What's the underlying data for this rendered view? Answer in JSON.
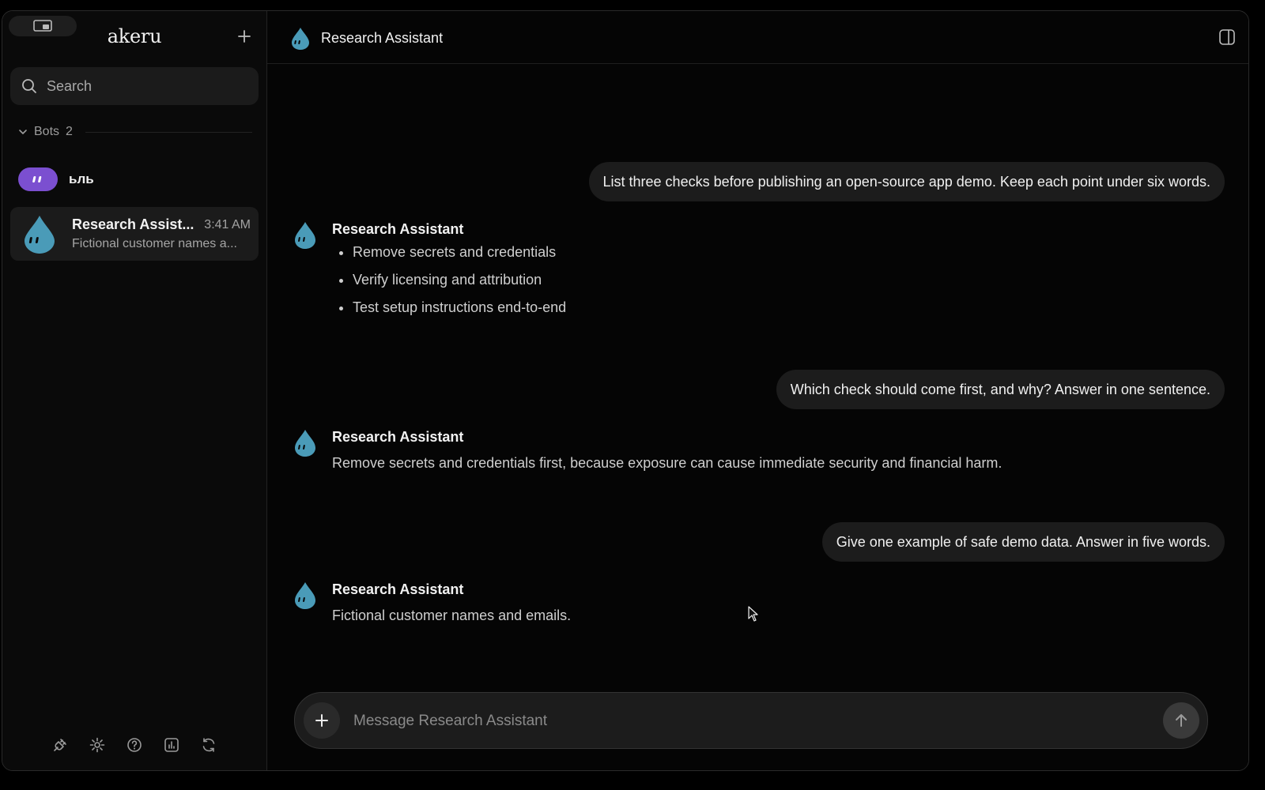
{
  "app": {
    "brand": "akeru"
  },
  "search": {
    "placeholder": "Search"
  },
  "bots_section": {
    "label": "Bots",
    "count": "2"
  },
  "bots": [
    {
      "name": "ьль",
      "color": "#7b4fd0"
    }
  ],
  "chats": [
    {
      "title": "Research Assist...",
      "time": "3:41 AM",
      "preview": "Fictional customer names a..."
    }
  ],
  "header": {
    "title": "Research Assistant"
  },
  "messages": {
    "user_1": "List three checks before publishing an open-source app demo. Keep each point under six words.",
    "bot_1_name": "Research Assistant",
    "bot_1_items": [
      "Remove secrets and credentials",
      "Verify licensing and attribution",
      "Test setup instructions end-to-end"
    ],
    "user_2": "Which check should come first, and why? Answer in one sentence.",
    "bot_2_name": "Research Assistant",
    "bot_2_text": "Remove secrets and credentials first, because exposure can cause immediate security and financial harm.",
    "user_3": "Give one example of safe demo data. Answer in five words.",
    "bot_3_name": "Research Assistant",
    "bot_3_text": "Fictional customer names and emails."
  },
  "composer": {
    "placeholder": "Message Research Assistant"
  },
  "colors": {
    "accent_drop": "#4a9bb8",
    "bot_pill": "#7b4fd0"
  },
  "footer_icons": [
    "plug-icon",
    "gear-icon",
    "help-icon",
    "chart-icon",
    "refresh-icon"
  ]
}
